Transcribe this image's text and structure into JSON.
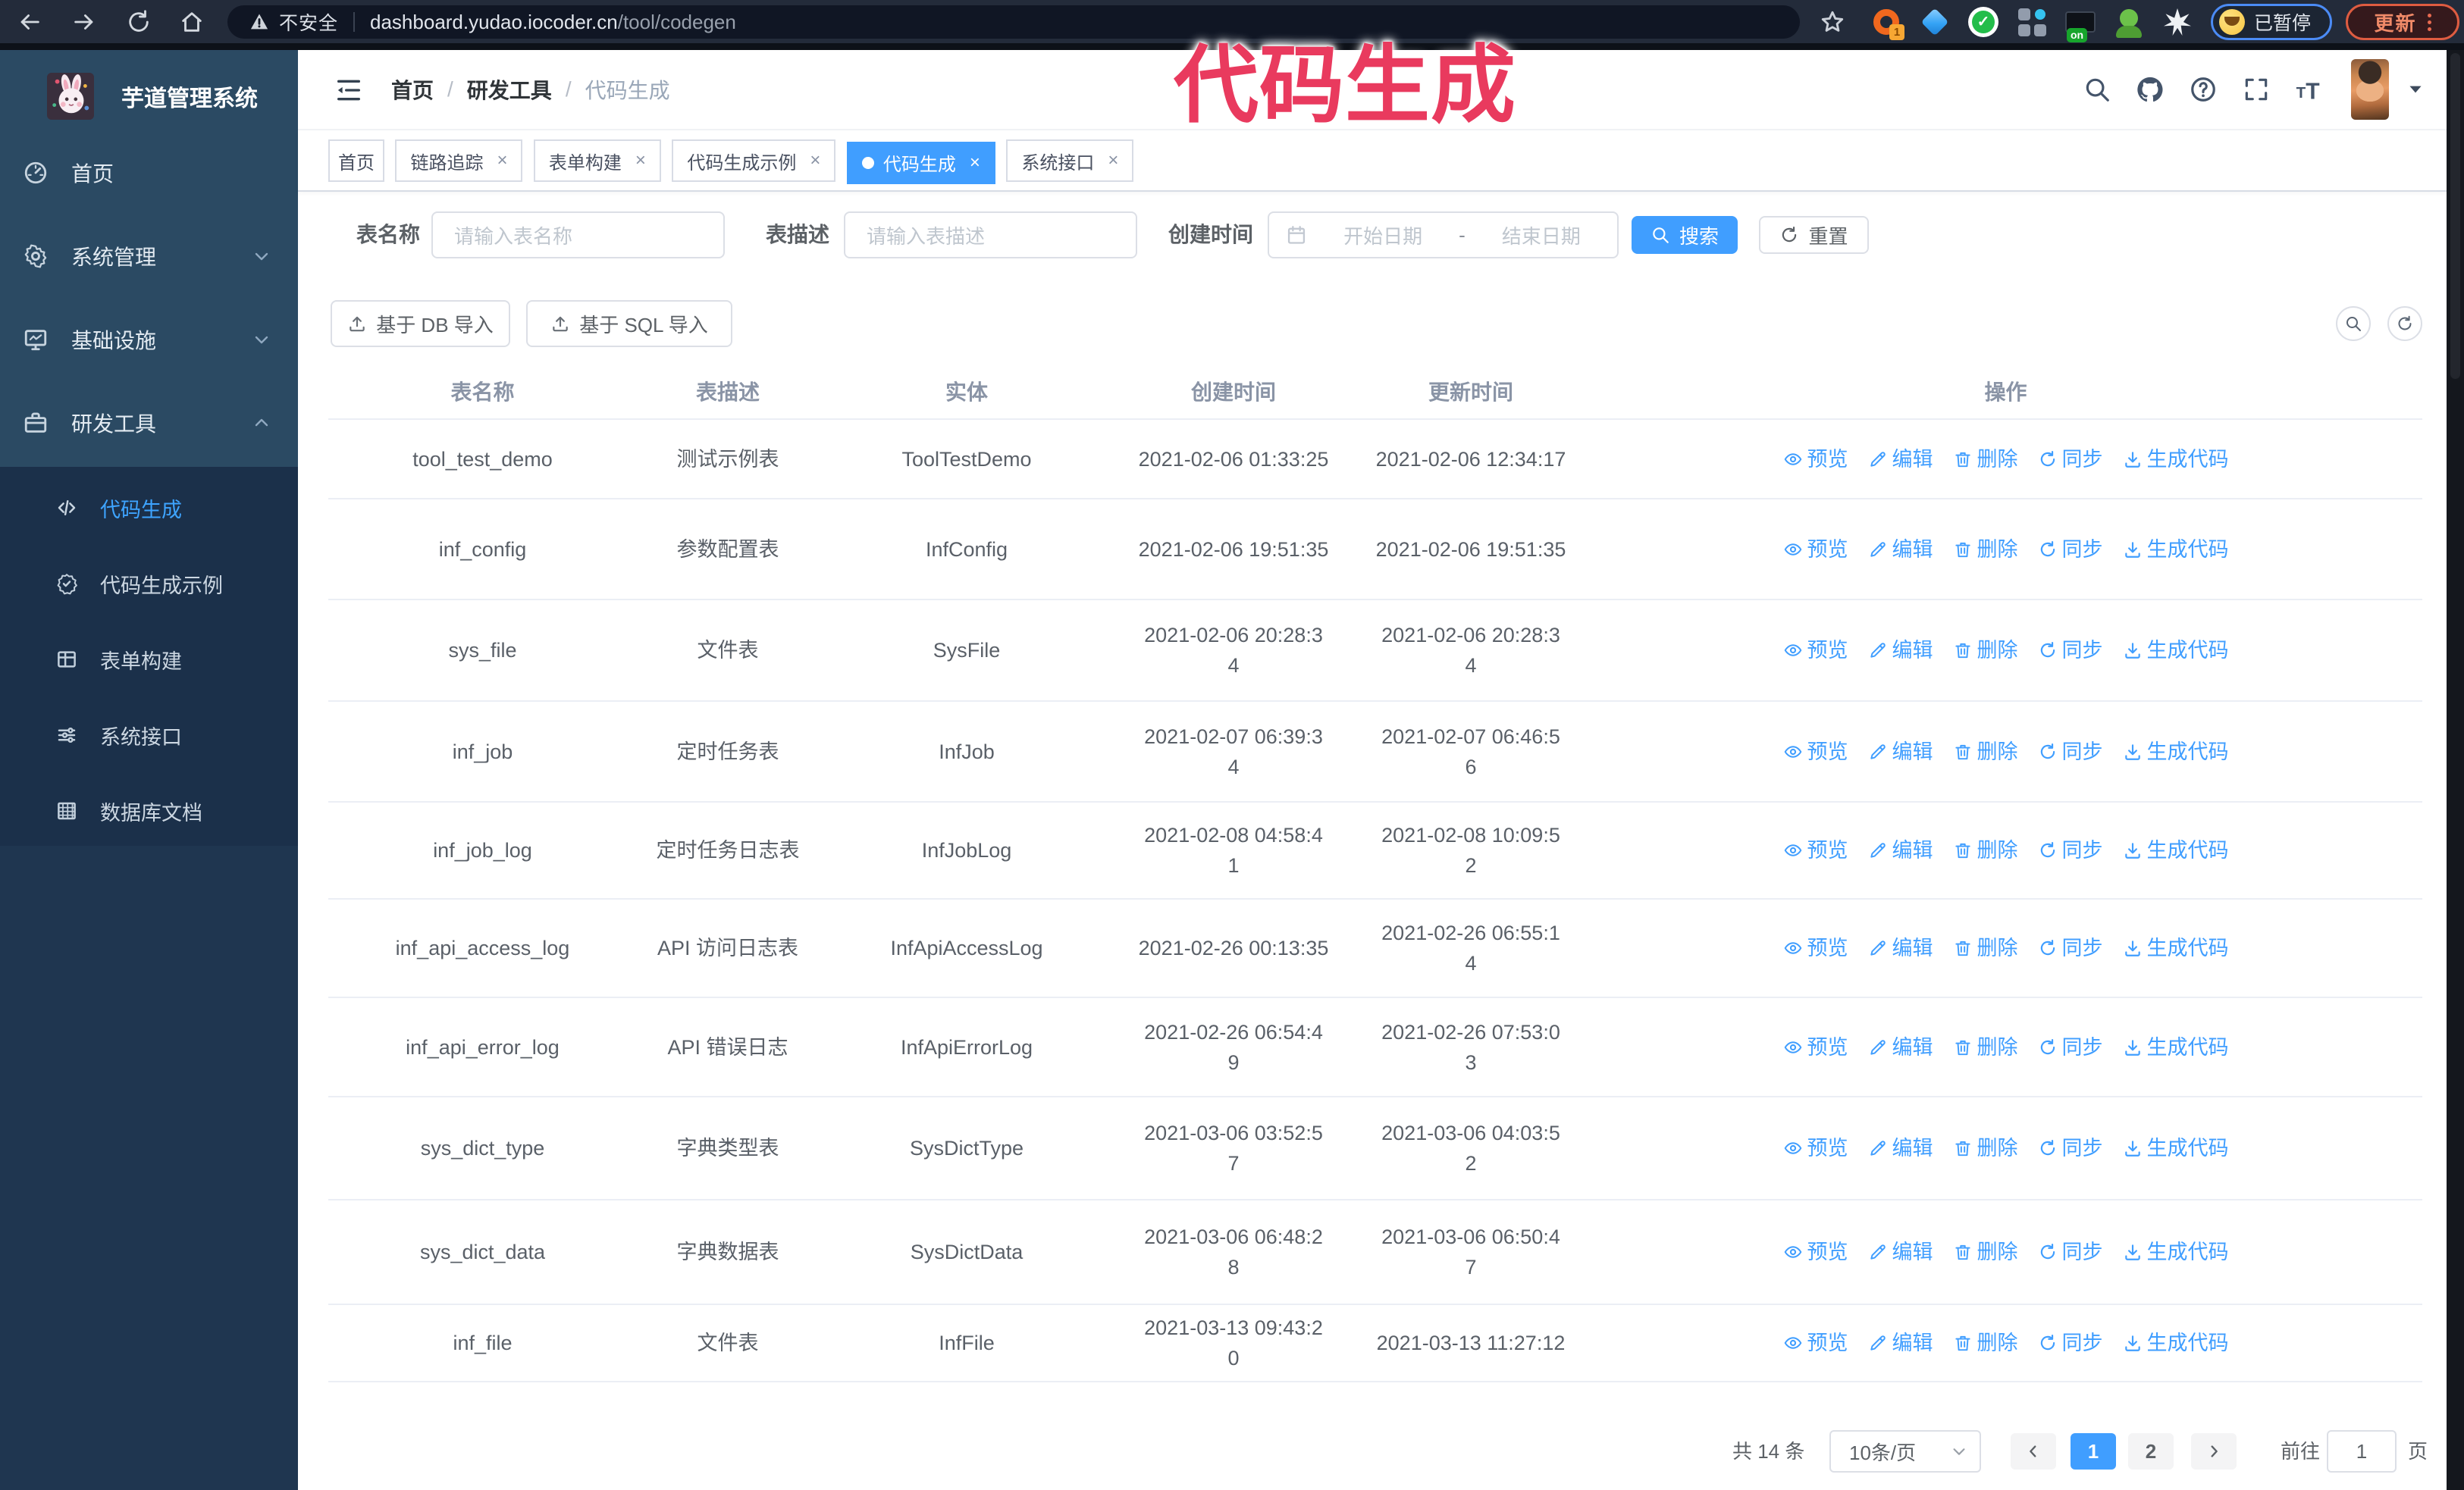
{
  "browser": {
    "security_label": "不安全",
    "url_host": "dashboard.yudao.iocoder.cn",
    "url_path": "/tool/codegen",
    "paused_badge_label": "已暂停",
    "update_button_label": "更新",
    "extensions": [
      {
        "icon": "ext-donut",
        "badge": "1"
      },
      {
        "icon": "ext-gem"
      },
      {
        "icon": "ext-circle-check"
      },
      {
        "icon": "ext-grid"
      },
      {
        "icon": "ext-onbox",
        "badge": "on"
      },
      {
        "icon": "ext-person"
      },
      {
        "icon": "ext-pinwheel"
      }
    ]
  },
  "annotation": {
    "text": "代码生成",
    "color": "#e93a5e"
  },
  "sidebar": {
    "logo_title": "芋道管理系统",
    "items": [
      {
        "label": "首页",
        "icon": "dashboard",
        "arrow": ""
      },
      {
        "label": "系统管理",
        "icon": "gear",
        "arrow": "down"
      },
      {
        "label": "基础设施",
        "icon": "monitor",
        "arrow": "down"
      },
      {
        "label": "研发工具",
        "icon": "briefcase",
        "arrow": "up"
      }
    ],
    "sub_items": [
      {
        "label": "代码生成",
        "icon": "code",
        "active": true
      },
      {
        "label": "代码生成示例",
        "icon": "badge-check",
        "active": false
      },
      {
        "label": "表单构建",
        "icon": "form-grid",
        "active": false
      },
      {
        "label": "系统接口",
        "icon": "sliders",
        "active": false
      },
      {
        "label": "数据库文档",
        "icon": "table-rows",
        "active": false
      }
    ]
  },
  "breadcrumb": {
    "home": "首页",
    "section": "研发工具",
    "current": "代码生成"
  },
  "tabs": [
    {
      "label": "首页",
      "closable": false,
      "active": false
    },
    {
      "label": "链路追踪",
      "closable": true,
      "active": false
    },
    {
      "label": "表单构建",
      "closable": true,
      "active": false
    },
    {
      "label": "代码生成示例",
      "closable": true,
      "active": false
    },
    {
      "label": "代码生成",
      "closable": true,
      "active": true
    },
    {
      "label": "系统接口",
      "closable": true,
      "active": false
    }
  ],
  "filters": {
    "table_name_label": "表名称",
    "table_name_placeholder": "请输入表名称",
    "table_desc_label": "表描述",
    "table_desc_placeholder": "请输入表描述",
    "create_time_label": "创建时间",
    "date_start_placeholder": "开始日期",
    "date_separator": "-",
    "date_end_placeholder": "结束日期",
    "search_label": "搜索",
    "reset_label": "重置"
  },
  "toolbar": {
    "import_db_label": "基于 DB 导入",
    "import_sql_label": "基于 SQL 导入"
  },
  "table": {
    "columns": [
      "表名称",
      "表描述",
      "实体",
      "创建时间",
      "更新时间",
      "操作"
    ],
    "actions": [
      {
        "label": "预览",
        "icon": "eye"
      },
      {
        "label": "编辑",
        "icon": "pencil"
      },
      {
        "label": "删除",
        "icon": "trash"
      },
      {
        "label": "同步",
        "icon": "sync"
      },
      {
        "label": "生成代码",
        "icon": "download"
      }
    ],
    "rows": [
      {
        "name": "tool_test_demo",
        "desc": "测试示例表",
        "entity": "ToolTestDemo",
        "created": "2021-02-06 01:33:25",
        "updated": "2021-02-06 12:34:17"
      },
      {
        "name": "inf_config",
        "desc": "参数配置表",
        "entity": "InfConfig",
        "created": "2021-02-06 19:51:35",
        "updated": "2021-02-06 19:51:35"
      },
      {
        "name": "sys_file",
        "desc": "文件表",
        "entity": "SysFile",
        "created": "2021-02-06 20:28:3\n4",
        "updated": "2021-02-06 20:28:3\n4"
      },
      {
        "name": "inf_job",
        "desc": "定时任务表",
        "entity": "InfJob",
        "created": "2021-02-07 06:39:3\n4",
        "updated": "2021-02-07 06:46:5\n6"
      },
      {
        "name": "inf_job_log",
        "desc": "定时任务日志表",
        "entity": "InfJobLog",
        "created": "2021-02-08 04:58:4\n1",
        "updated": "2021-02-08 10:09:5\n2"
      },
      {
        "name": "inf_api_access_log",
        "desc": "API 访问日志表",
        "entity": "InfApiAccessLog",
        "created": "2021-02-26 00:13:35",
        "updated": "2021-02-26 06:55:1\n4"
      },
      {
        "name": "inf_api_error_log",
        "desc": "API 错误日志",
        "entity": "InfApiErrorLog",
        "created": "2021-02-26 06:54:4\n9",
        "updated": "2021-02-26 07:53:0\n3"
      },
      {
        "name": "sys_dict_type",
        "desc": "字典类型表",
        "entity": "SysDictType",
        "created": "2021-03-06 03:52:5\n7",
        "updated": "2021-03-06 04:03:5\n2"
      },
      {
        "name": "sys_dict_data",
        "desc": "字典数据表",
        "entity": "SysDictData",
        "created": "2021-03-06 06:48:2\n8",
        "updated": "2021-03-06 06:50:4\n7"
      },
      {
        "name": "inf_file",
        "desc": "文件表",
        "entity": "InfFile",
        "created": "2021-03-13 09:43:2\n0",
        "updated": "2021-03-13 11:27:12"
      }
    ]
  },
  "pagination": {
    "total_text": "共 14 条",
    "page_size_value": "10条/页",
    "pages": [
      {
        "label": "1",
        "active": true
      },
      {
        "label": "2",
        "active": false
      }
    ],
    "jump_prefix": "前往",
    "jump_value": "1",
    "jump_suffix": "页"
  },
  "colors": {
    "accent": "#409eff",
    "sidebar_bg": "#2b4a63",
    "submenu_bg": "#1b304a",
    "chrome_bg": "#232b3a"
  }
}
